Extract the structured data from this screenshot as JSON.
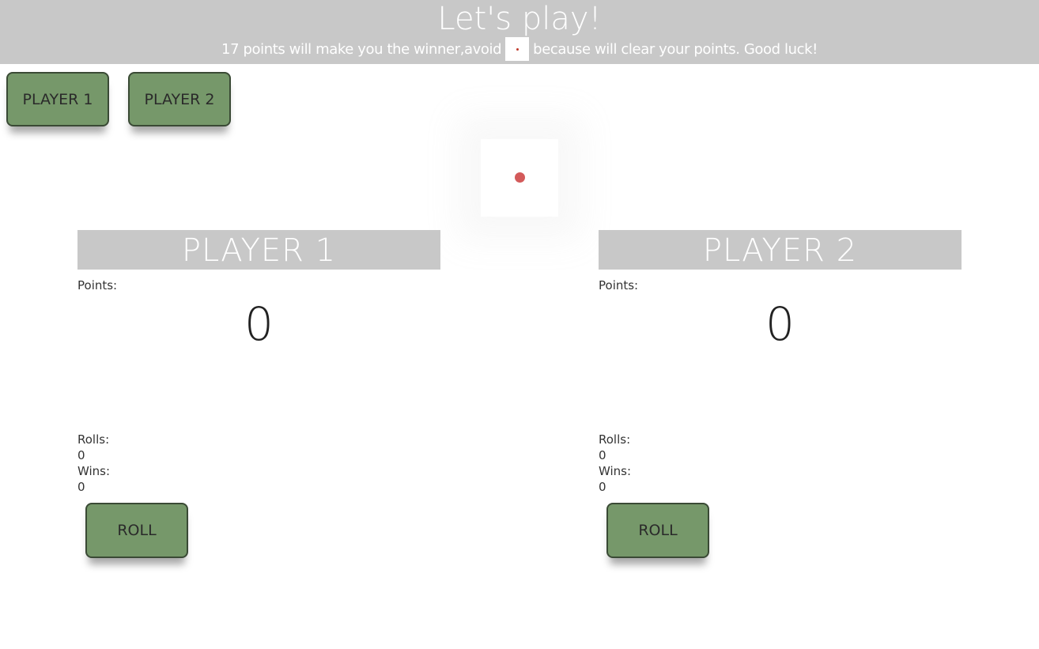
{
  "header": {
    "title": "Let's play!",
    "subtitle_before": "17 points will make you the winner,avoid",
    "subtitle_after": "because will clear your points. Good luck!"
  },
  "player_select": {
    "player1_label": "PLAYER 1",
    "player2_label": "PLAYER 2"
  },
  "die": {
    "face_value": 1,
    "pip_color": "#d35a5a"
  },
  "players": [
    {
      "title": "PLAYER 1",
      "points_label": "Points:",
      "points": "0",
      "rolls_label": "Rolls:",
      "rolls": "0",
      "wins_label": "Wins:",
      "wins": "0",
      "roll_button": "ROLL"
    },
    {
      "title": "PLAYER 2",
      "points_label": "Points:",
      "points": "0",
      "rolls_label": "Rolls:",
      "rolls": "0",
      "wins_label": "Wins:",
      "wins": "0",
      "roll_button": "ROLL"
    }
  ],
  "colors": {
    "header_bg": "#c8c8c8",
    "button_bg": "#76986a",
    "text": "#222222"
  }
}
